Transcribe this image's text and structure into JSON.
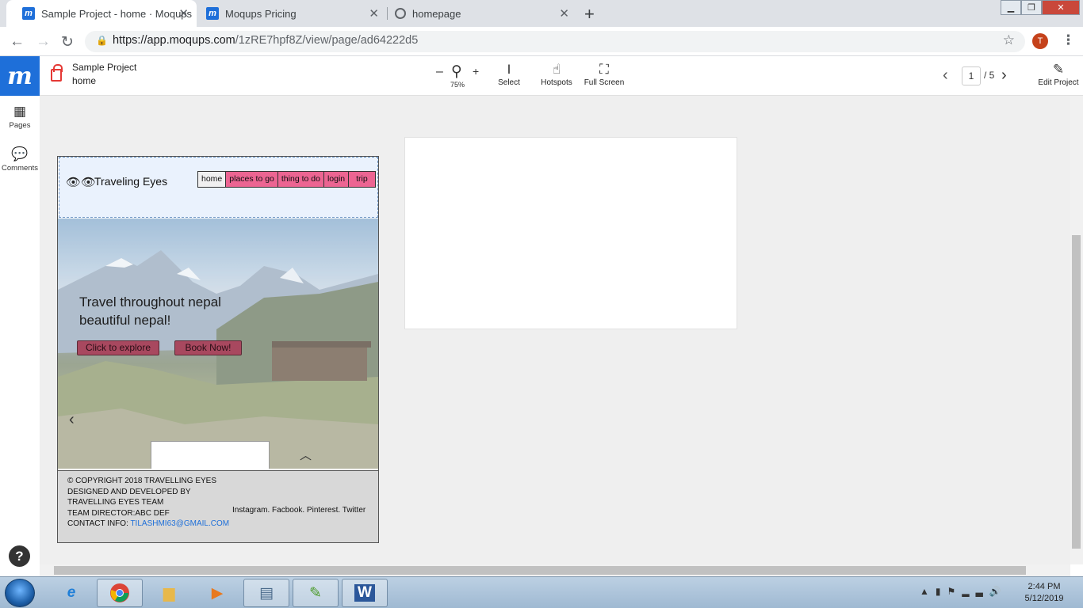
{
  "browser": {
    "tabs": [
      {
        "title": "Sample Project - home · Moqups",
        "favicon": "moqups-icon"
      },
      {
        "title": "Moqups Pricing",
        "favicon": "moqups-icon"
      },
      {
        "title": "homepage",
        "favicon": "globe-icon"
      }
    ],
    "url_prefix": "https://app.moqups.com",
    "url_path": "/1zRE7hpf8Z/view/page/ad64222d5",
    "profile_initial": "T"
  },
  "app": {
    "logo": "m",
    "project_name": "Sample Project",
    "page_name": "home",
    "zoom_value": "75%",
    "tools": {
      "select": "Select",
      "hotspots": "Hotspots",
      "fullscreen": "Full Screen",
      "edit": "Edit Project"
    },
    "page_current": "1",
    "page_total": "/ 5",
    "sidebar": {
      "pages": "Pages",
      "comments": "Comments"
    },
    "help": "?"
  },
  "mockup": {
    "brand": "Traveling Eyes",
    "nav": [
      "home",
      "places to go",
      "thing to do",
      "login",
      "trip"
    ],
    "hero_line1": "Travel throughout nepal",
    "hero_line2": "beautiful nepal!",
    "btn_explore": "Click to explore",
    "btn_book": "Book Now!",
    "footer": {
      "line1": "© COPYRIGHT 2018 TRAVELLING EYES",
      "line2": "DESIGNED AND DEVELOPED BY",
      "line3": "TRAVELLING EYES TEAM",
      "line4": "TEAM DIRECTOR:ABC DEF",
      "line5_label": "CONTACT INFO: ",
      "line5_email": "TILASHMI63@GMAIL.COM",
      "social": "Instagram. Facbook. Pinterest. Twitter"
    }
  },
  "taskbar": {
    "time": "2:44 PM",
    "date": "5/12/2019"
  },
  "colors": {
    "moqups_blue": "#1e6fd9",
    "nav_pink": "#ec6592",
    "button_rose": "#a8485f"
  }
}
